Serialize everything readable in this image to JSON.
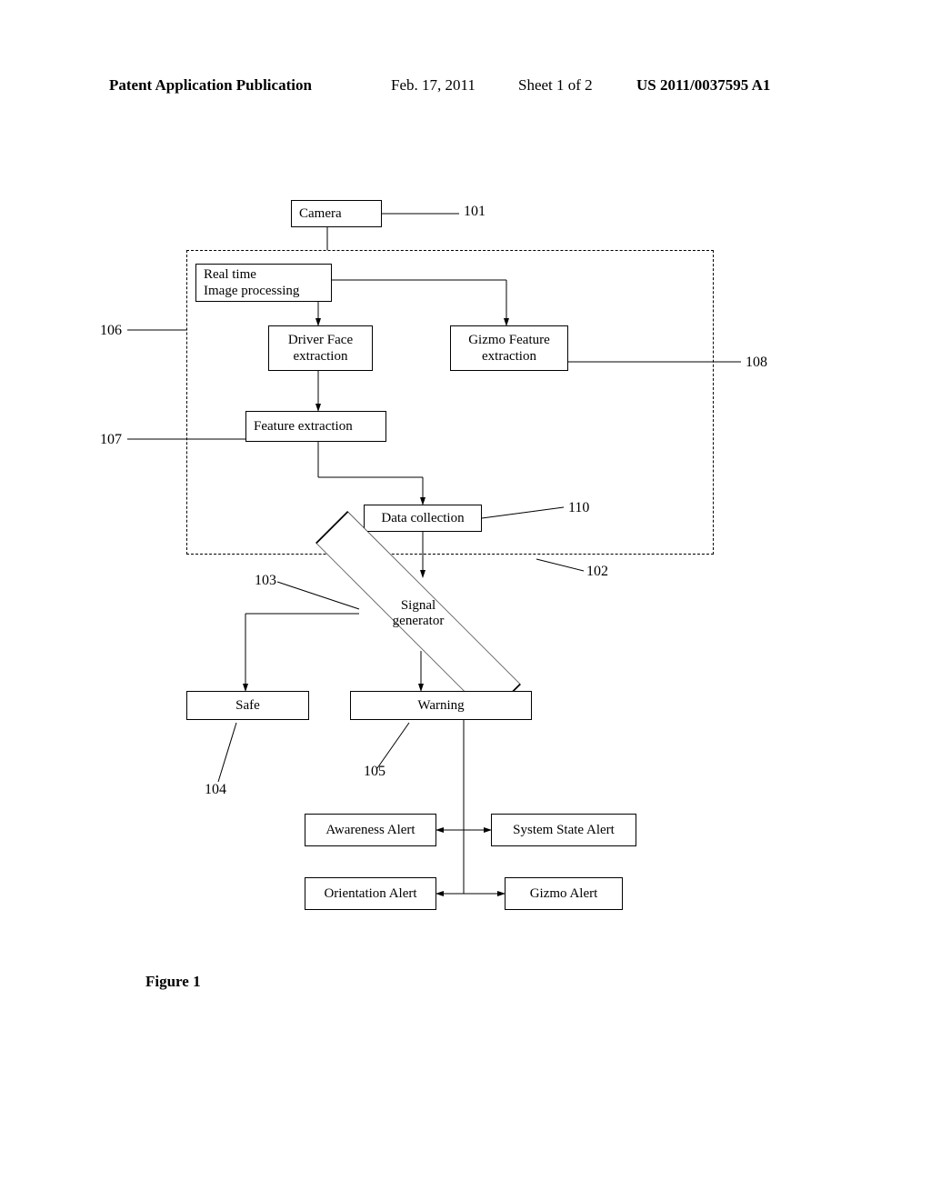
{
  "header": {
    "left": "Patent Application Publication",
    "date": "Feb. 17, 2011",
    "sheet": "Sheet 1 of 2",
    "pubnum": "US 2011/0037595 A1"
  },
  "boxes": {
    "camera": "Camera",
    "realtime_l1": "Real time",
    "realtime_l2": "Image processing",
    "driverface_l1": "Driver Face",
    "driverface_l2": "extraction",
    "gizmo_l1": "Gizmo Feature",
    "gizmo_l2": "extraction",
    "feature": "Feature extraction",
    "datacoll": "Data collection",
    "signal_l1": "Signal",
    "signal_l2": "generator",
    "safe": "Safe",
    "warning": "Warning",
    "awareness": "Awareness Alert",
    "systemstate": "System State Alert",
    "orientation": "Orientation Alert",
    "gizmo_alert": "Gizmo Alert"
  },
  "refs": {
    "r101": "101",
    "r102": "102",
    "r103": "103",
    "r104": "104",
    "r105": "105",
    "r106": "106",
    "r107": "107",
    "r108": "108",
    "r110": "110"
  },
  "figure": "Figure 1"
}
